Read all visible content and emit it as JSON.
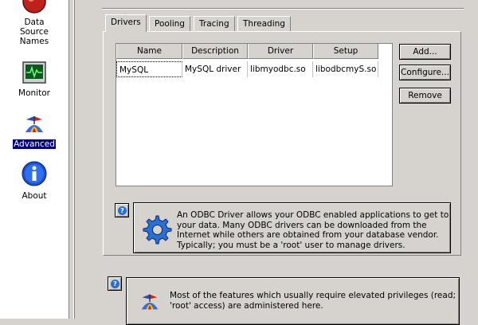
{
  "sidebar": {
    "items": [
      {
        "label_lines": [
          "Data",
          "Source",
          "Names"
        ],
        "icon": "database-icon",
        "selected": false
      },
      {
        "label_lines": [
          "Monitor"
        ],
        "icon": "monitor-icon",
        "selected": false
      },
      {
        "label_lines": [
          "Advanced"
        ],
        "icon": "propeller-hat-icon",
        "selected": true
      },
      {
        "label_lines": [
          "About"
        ],
        "icon": "info-icon",
        "selected": false
      }
    ]
  },
  "tabs": [
    {
      "label": "Drivers",
      "active": true
    },
    {
      "label": "Pooling",
      "active": false
    },
    {
      "label": "Tracing",
      "active": false
    },
    {
      "label": "Threading",
      "active": false
    }
  ],
  "drivers_table": {
    "columns": [
      "Name",
      "Description",
      "Driver",
      "Setup"
    ],
    "rows": [
      [
        "MySQL",
        "MySQL driver",
        "libmyodbc.so",
        "libodbcmyS.so"
      ]
    ]
  },
  "buttons": {
    "add": "Add...",
    "configure": "Configure...",
    "remove": "Remove"
  },
  "driver_info": {
    "icon": "gear-icon",
    "lines": [
      "An ODBC Driver allows your ODBC enabled applications to get to",
      "your data. Many ODBC drivers can be downloaded from the",
      "Internet while others are obtained from your database vendor.",
      "Typically; you must be a 'root' user to manage drivers."
    ]
  },
  "advanced_info": {
    "icon": "propeller-hat-icon",
    "lines": [
      "Most of the features which usually require elevated privileges (read;",
      "'root' access) are administered here."
    ]
  },
  "colors": {
    "window_bg": "#d6d3ce",
    "selection": "#000080",
    "help_icon": "#2a6fd6"
  }
}
